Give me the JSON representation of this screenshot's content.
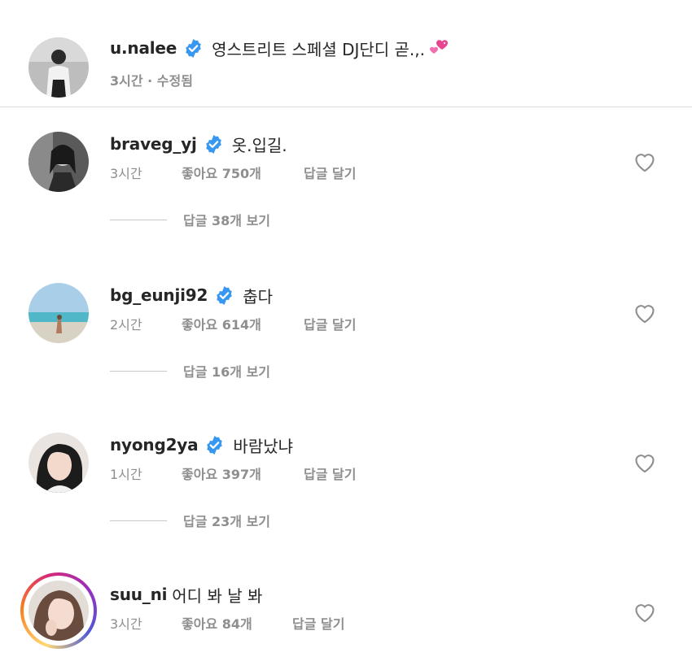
{
  "caption": {
    "username": "u.nalee",
    "text": "영스트리트 스페셜 DJ단디 곧.,.",
    "emoji": "heart-revolving-icon",
    "meta": "3시간 · 수정됨"
  },
  "comments": [
    {
      "username": "braveg_yj",
      "text": "옷.입길.",
      "time": "3시간",
      "likes": "좋아요 750개",
      "reply": "답글 달기",
      "view_replies": "답글 38개 보기",
      "verified": true
    },
    {
      "username": "bg_eunji92",
      "text": "춥다",
      "time": "2시간",
      "likes": "좋아요 614개",
      "reply": "답글 달기",
      "view_replies": "답글 16개 보기",
      "verified": true
    },
    {
      "username": "nyong2ya",
      "text": "바람났냐",
      "time": "1시간",
      "likes": "좋아요 397개",
      "reply": "답글 달기",
      "view_replies": "답글 23개 보기",
      "verified": true
    },
    {
      "username": "suu_ni",
      "text": "어디 봐 날 봐",
      "time": "3시간",
      "likes": "좋아요 84개",
      "reply": "답글 달기",
      "verified": false,
      "story_ring": true
    }
  ],
  "colors": {
    "verified_blue": "#3897f0",
    "meta_gray": "#8e8e8e",
    "story_ring": [
      "#feda75",
      "#fa7e1e",
      "#d62976",
      "#962fbf",
      "#4f5bd5"
    ],
    "emoji_pink": "#e8448f"
  },
  "icons": {
    "verified": "verified-badge-icon",
    "like": "heart-outline-icon"
  }
}
